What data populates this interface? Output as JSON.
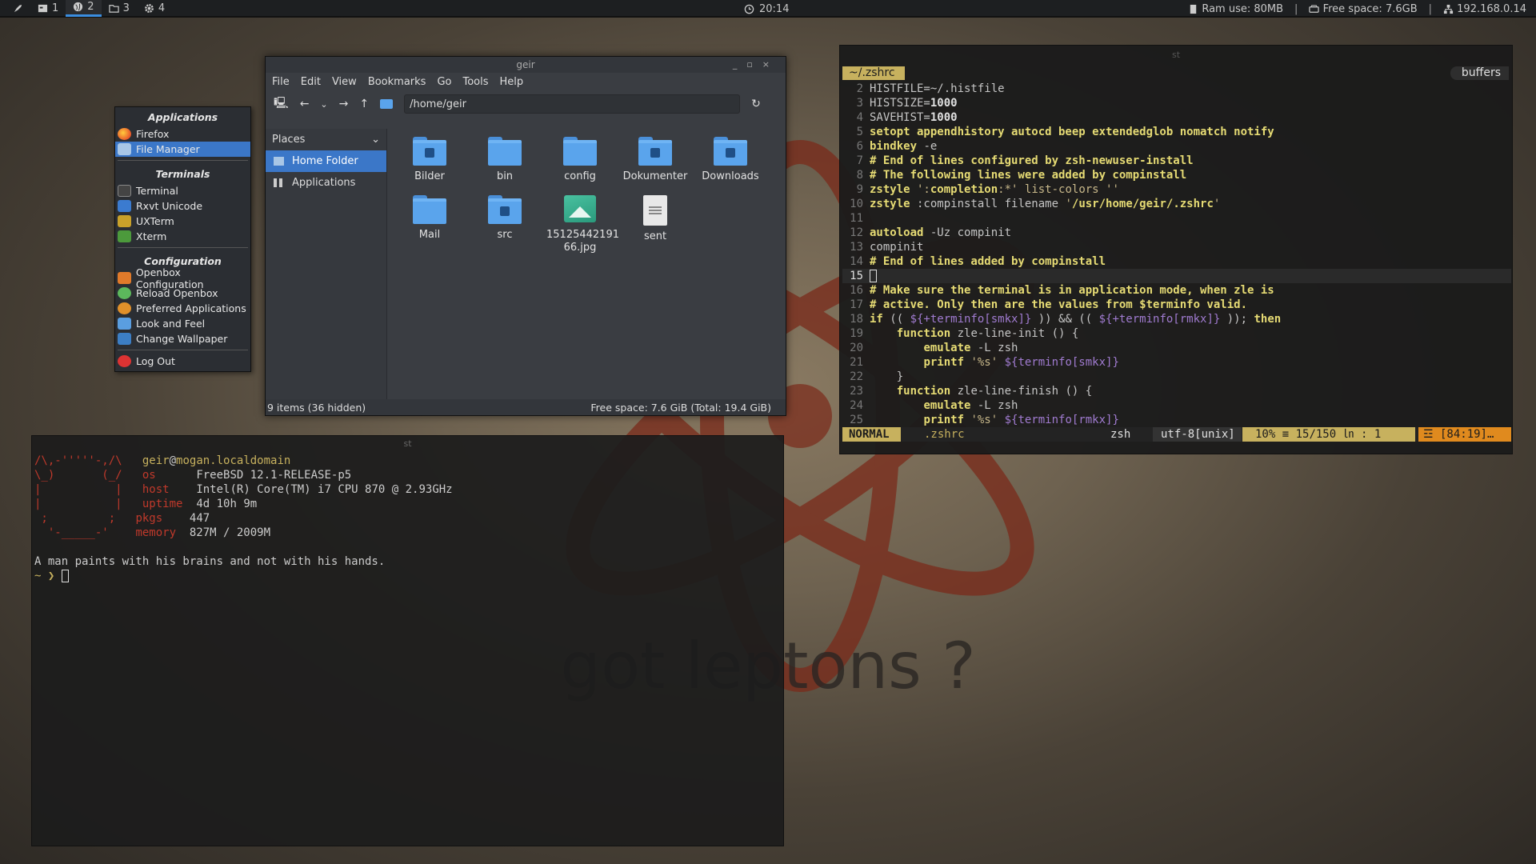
{
  "topbar": {
    "workspaces": [
      {
        "num": "1",
        "icon": "terminal-icon"
      },
      {
        "num": "2",
        "icon": "globe-icon",
        "active": true
      },
      {
        "num": "3",
        "icon": "folder-icon"
      },
      {
        "num": "4",
        "icon": "gear-icon"
      }
    ],
    "clock": "20:14",
    "ram": "Ram use: 80MB",
    "free": "Free space: 7.6GB",
    "ip": "192.168.0.14",
    "sep": "|"
  },
  "menu": {
    "apps_header": "Applications",
    "firefox": "Firefox",
    "file_manager": "File Manager",
    "terminals_header": "Terminals",
    "terminal": "Terminal",
    "rxvt": "Rxvt Unicode",
    "uxterm": "UXTerm",
    "xterm": "Xterm",
    "config_header": "Configuration",
    "openbox_config": "Openbox Configuration",
    "reload": "Reload Openbox",
    "preferred": "Preferred Applications",
    "look": "Look and Feel",
    "wallpaper": "Change Wallpaper",
    "logout": "Log Out"
  },
  "file_manager": {
    "title": "geir",
    "menus": [
      "File",
      "Edit",
      "View",
      "Bookmarks",
      "Go",
      "Tools",
      "Help"
    ],
    "path": "/home/geir",
    "places_label": "Places",
    "places": [
      "Home Folder",
      "Applications"
    ],
    "items": [
      "Bilder",
      "bin",
      "config",
      "Dokumenter",
      "Downloads",
      "Mail",
      "src",
      "15125442191 66.jpg",
      "sent"
    ],
    "status_left": "9 items (36 hidden)",
    "status_right": "Free space: 7.6 GiB (Total: 19.4 GiB)"
  },
  "neofetch": {
    "user": "geir",
    "at": "@",
    "host": "mogan.localdomain",
    "ascii": [
      "/\\,-'''''-,/\\",
      "\\_)       (_/",
      "|           |",
      "|           |",
      " ;         ;",
      "  '-_____-'"
    ],
    "labels": [
      "os",
      "host",
      "uptime",
      "pkgs",
      "memory"
    ],
    "values": [
      "FreeBSD 12.1-RELEASE-p5",
      "Intel(R) Core(TM) i7 CPU 870 @ 2.93GHz",
      "4d 10h 9m",
      "447",
      "827M / 2009M"
    ],
    "quote": "A man paints with his brains and not with his hands.",
    "prompt": "~ ❯"
  },
  "vim": {
    "tab": "~/.zshrc",
    "buffers": "buffers",
    "mode": "NORMAL",
    "filename": ".zshrc",
    "filetype": "zsh",
    "encoding": "utf-8[unix]",
    "percent": "10% ≡",
    "lines": "15/150 ㏑ :  1",
    "warn": "☲ [84:19]…",
    "wallpaper_text": "got leptons ?"
  },
  "colors": {
    "accent": "#3b77c8",
    "vim_yellow": "#c7b15e",
    "vim_orange": "#e08a1e",
    "logo_red": "#c0392b"
  }
}
